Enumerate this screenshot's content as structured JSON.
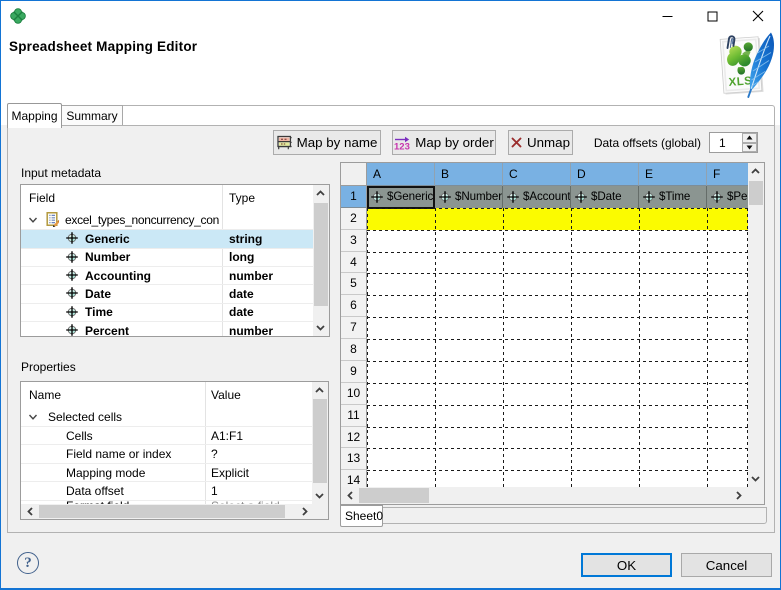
{
  "header": {
    "title": "Spreadsheet Mapping Editor"
  },
  "titlebar": {
    "app_icon": "clover-icon",
    "minimize_icon": "minimize-icon",
    "maximize_icon": "maximize-icon",
    "close_icon": "close-icon",
    "document_icon": "xls-feather-icon"
  },
  "tabs": [
    {
      "label": "Mapping",
      "active": true
    },
    {
      "label": "Summary",
      "active": false
    }
  ],
  "toolbar": {
    "map_by_name_label": "Map by name",
    "map_by_name_icon": "table-icon",
    "map_by_order_label": "Map by order",
    "map_by_order_icon": "numbers-arrow-icon",
    "unmap_label": "Unmap",
    "unmap_icon": "red-cross-icon",
    "data_offsets_label": "Data offsets (global)",
    "data_offsets_value": "1"
  },
  "input_metadata": {
    "label": "Input metadata",
    "columns": [
      "Field",
      "Type"
    ],
    "root": {
      "name": "excel_types_noncurrency_con",
      "icon": "record-metadata-icon",
      "expanded": true
    },
    "fields": [
      {
        "name": "Generic",
        "type": "string",
        "selected": true,
        "icon": "field-crosshair-icon"
      },
      {
        "name": "Number",
        "type": "long",
        "selected": false,
        "icon": "field-crosshair-icon"
      },
      {
        "name": "Accounting",
        "type": "number",
        "selected": false,
        "icon": "field-crosshair-icon"
      },
      {
        "name": "Date",
        "type": "date",
        "selected": false,
        "icon": "field-crosshair-icon"
      },
      {
        "name": "Time",
        "type": "date",
        "selected": false,
        "icon": "field-crosshair-icon"
      },
      {
        "name": "Percent",
        "type": "number",
        "selected": false,
        "icon": "field-crosshair-icon"
      }
    ]
  },
  "properties": {
    "label": "Properties",
    "columns": [
      "Name",
      "Value"
    ],
    "group": {
      "name": "Selected cells",
      "expanded": true
    },
    "rows": [
      {
        "name": "Cells",
        "value": "A1:F1",
        "muted": false
      },
      {
        "name": "Field name or index",
        "value": "?",
        "muted": false
      },
      {
        "name": "Mapping mode",
        "value": "Explicit",
        "muted": false
      },
      {
        "name": "Data offset",
        "value": "1",
        "muted": false
      },
      {
        "name": "Format field",
        "value": "Select a field",
        "muted": true
      }
    ]
  },
  "spreadsheet": {
    "column_headers": [
      "A",
      "B",
      "C",
      "D",
      "E",
      "F"
    ],
    "visible_row_count": 14,
    "focused_cell": "A1",
    "mapped_cells": [
      {
        "cell": "A1",
        "value": "$Generic",
        "icon": "field-crosshair-icon"
      },
      {
        "cell": "B1",
        "value": "$Number",
        "icon": "field-crosshair-icon"
      },
      {
        "cell": "C1",
        "value": "$Accounting",
        "icon": "field-crosshair-icon"
      },
      {
        "cell": "D1",
        "value": "$Date",
        "icon": "field-crosshair-icon"
      },
      {
        "cell": "E1",
        "value": "$Time",
        "icon": "field-crosshair-icon"
      },
      {
        "cell": "F1",
        "value": "$Percent",
        "icon": "field-crosshair-icon"
      }
    ],
    "highlighted_data_row": 2,
    "sheet_tabs": [
      "Sheet0"
    ]
  },
  "footer": {
    "help_icon": "help-icon",
    "help_glyph": "?",
    "ok_label": "OK",
    "cancel_label": "Cancel"
  },
  "colors": {
    "window_border": "#1374d4",
    "titlebar_bg": "#ffffff",
    "dialog_bg": "#f0f0f0",
    "selection_blue": "#cbe8f6",
    "grid_header_blue": "#79b1e3",
    "mapped_cell_gray": "#8b9591",
    "data_row_yellow": "#fbfb00",
    "ok_border_blue": "#0078d7",
    "clover_green": "#2f9e53"
  }
}
